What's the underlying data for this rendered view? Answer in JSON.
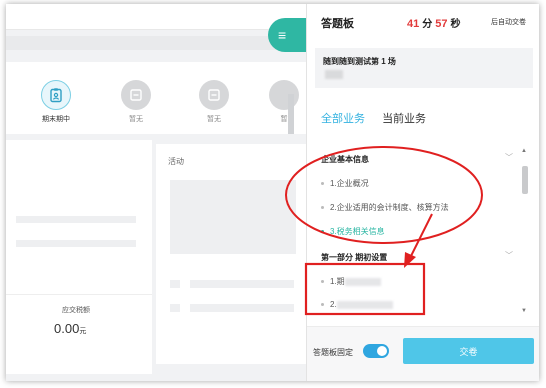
{
  "background": {
    "menu_icon": "≡",
    "modules": [
      {
        "label": "期末期中",
        "active": true,
        "icon": "clipboard-icon"
      },
      {
        "label": "暂无",
        "active": false,
        "icon": "placeholder-icon"
      },
      {
        "label": "暂无",
        "active": false,
        "icon": "placeholder-icon"
      },
      {
        "label": "暂",
        "active": false,
        "icon": "placeholder-icon"
      }
    ],
    "activity_title": "活动",
    "payable_label": "应交税额",
    "payable_amount": "0.00",
    "payable_unit": "元"
  },
  "panel": {
    "title": "答题板",
    "timer": {
      "minutes": "41",
      "minutes_unit": "分",
      "seconds": "57",
      "seconds_unit": "秒"
    },
    "auto_submit": "后自动交卷",
    "exam_name": "随到随到测试第 1 场",
    "tabs": [
      {
        "label": "全部业务",
        "active": true
      },
      {
        "label": "当前业务",
        "active": false
      }
    ],
    "sections": [
      {
        "title": "企业基本信息",
        "items": [
          {
            "label": "1.企业概况",
            "done": false
          },
          {
            "label": "2.企业适用的会计制度、核算方法",
            "done": false
          },
          {
            "label": "3.税务相关信息",
            "done": true
          }
        ]
      },
      {
        "title": "第一部分 期初设置",
        "items": [
          {
            "label": "1.期",
            "done": false
          },
          {
            "label": "2.",
            "done": false
          }
        ]
      }
    ],
    "fix_label": "答题板固定",
    "submit_label": "交卷"
  },
  "colors": {
    "accent": "#33b2e0",
    "timer_red": "#e23b3b",
    "teal": "#2fb7a3",
    "annotation_red": "#e02020"
  }
}
